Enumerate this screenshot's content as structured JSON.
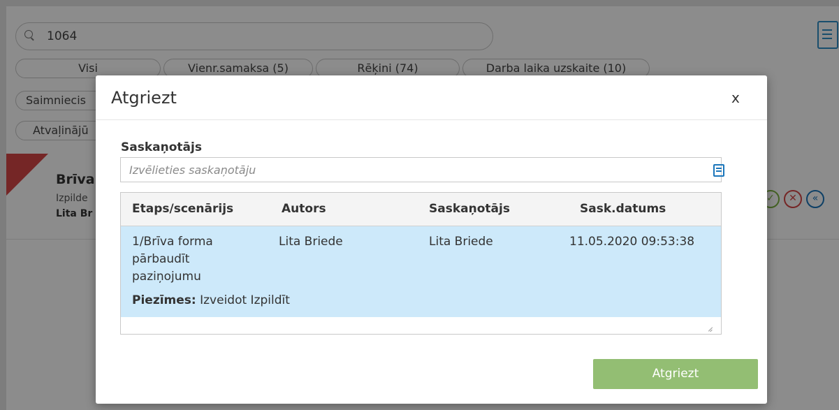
{
  "search": {
    "value": "1064"
  },
  "filters": [
    {
      "label": "Visi"
    },
    {
      "label": "Vienr.samaksa (5)"
    },
    {
      "label": "Rēķini (74)"
    },
    {
      "label": "Darba laika uzskaite (10)"
    },
    {
      "label": "Saimniecis"
    },
    {
      "label": "Atvaļinājū"
    }
  ],
  "card": {
    "title": "Brīva",
    "subtitle": "Izpilde",
    "person": "Lita Br"
  },
  "actions": {
    "approve": {
      "icon": "check-circle-icon",
      "glyph": "✓",
      "color": "#7cb342"
    },
    "reject": {
      "icon": "x-circle-icon",
      "glyph": "✕",
      "color": "#d64545"
    },
    "return": {
      "icon": "rewind-circle-icon",
      "glyph": "«",
      "color": "#1b76bb"
    }
  },
  "modal": {
    "title": "Atgriezt",
    "close": "x",
    "field_label": "Saskaņotājs",
    "field_placeholder": "Izvēlieties saskaņotāju",
    "table": {
      "headers": [
        "Etaps/scenārijs",
        "Autors",
        "Saskaņotājs",
        "Sask.datums"
      ],
      "rows": [
        {
          "stage_line1": "1/Brīva forma",
          "stage_line2": "pārbaudīt",
          "stage_line3": "paziņojumu",
          "author": "Lita Briede",
          "approver": "Lita Briede",
          "date": "11.05.2020 09:53:38",
          "notes_label": "Piezīmes:",
          "notes_value": "Izveidot Izpildīt"
        }
      ]
    },
    "submit_label": "Atgriezt"
  },
  "colors": {
    "accent_blue": "#1b76bb",
    "selected_row": "#cde9fa",
    "submit_green": "#93be73",
    "flag_red": "#d64545"
  }
}
